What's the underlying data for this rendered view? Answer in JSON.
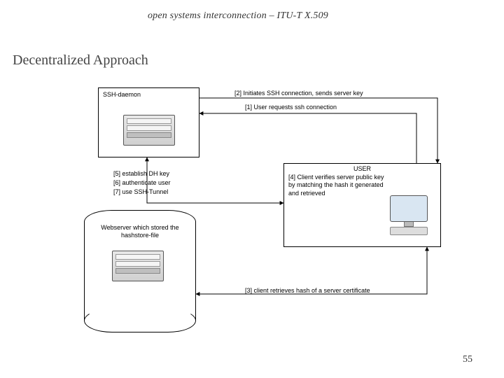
{
  "header": "open systems interconnection – ITU-T X.509",
  "title": "Decentralized Approach",
  "page_number": "55",
  "boxes": {
    "ssh_daemon": {
      "label": "SSH-daemon"
    },
    "user": {
      "label": "USER",
      "notes": "[4] Client verifies server public key by matching the hash it generated and retrieved"
    },
    "webserver": {
      "label": "Webserver which stored the hashstore-file"
    }
  },
  "steps": {
    "s1": "[1] User requests ssh connection",
    "s2": "[2] Initiates SSH connection, sends server key",
    "s3": "[3] client retrieves hash of a server certificate",
    "s5": "[5] establish DH key",
    "s6": "[6] authenticate user",
    "s7": "[7] use SSH-Tunnel"
  }
}
